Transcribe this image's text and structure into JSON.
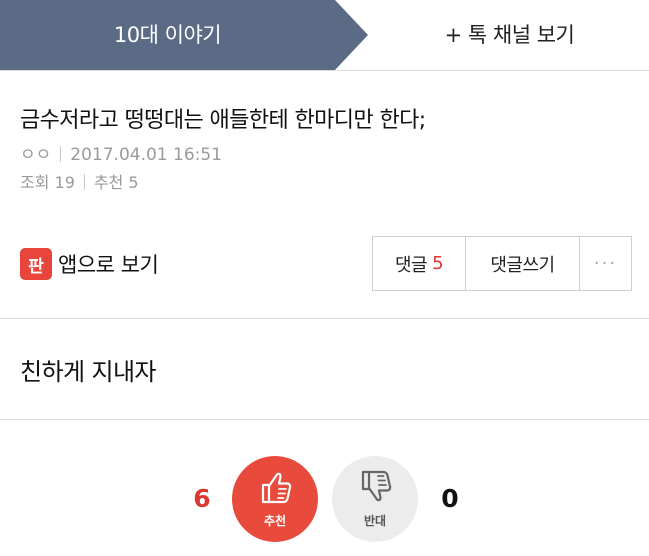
{
  "tabs": {
    "active_label": "10대 이야기",
    "channel_label": "+ 톡 채널 보기"
  },
  "post": {
    "title": "금수저라고 떵떵대는 애들한테 한마디만 한다;",
    "author": "ㅇㅇ",
    "date": "2017.04.01 16:51",
    "views": "조회 19",
    "recommend": "추천 5"
  },
  "actions": {
    "app_icon_text": "판",
    "app_view_label": "앱으로 보기",
    "comments_label": "댓글",
    "comments_count": "5",
    "write_comment_label": "댓글쓰기",
    "more_label": "···"
  },
  "content": {
    "body": "친하게 지내자"
  },
  "vote": {
    "up_label": "추천",
    "up_count": "6",
    "down_label": "반대",
    "down_count": "0"
  },
  "colors": {
    "tab_active": "#5b6b85",
    "accent_red": "#e84a3b",
    "count_red": "#d9392f"
  },
  "icons": {
    "app": "pann-app-icon",
    "vote_up": "thumbs-up-icon",
    "vote_down": "thumbs-down-icon"
  }
}
